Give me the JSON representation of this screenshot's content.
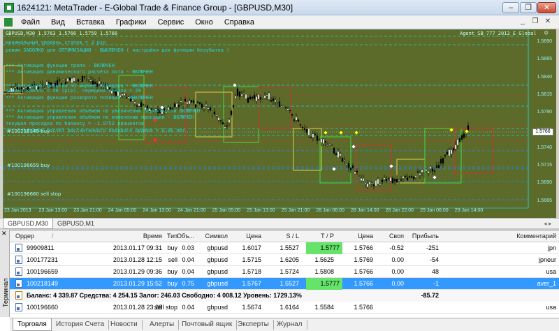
{
  "window": {
    "title": "1624121: MetaTrader - E-Global Trade & Finance Group - [GBPUSD,M30]"
  },
  "menu": [
    "Файл",
    "Вид",
    "Вставка",
    "Графики",
    "Сервис",
    "Окно",
    "Справка"
  ],
  "chart": {
    "symbol_line": "GBPUSD,M30  1.5763 1.5766 1.5759 1.5766",
    "expert_name": "Agent_SB_777_2013_E Global",
    "overlay_lines": [
      "минимальный уровень стопов =  3  pip",
      "режим ЗАБОЛКО для ОПТИМИЗАЦИИ - ВЫКЛЮЧЕН  ( настройки для функции безубытка )",
      "*** Активация функции трала - ВКЛЮЧЕН",
      "*** Активация динамического расчёта лота - ВКЛЮЧЕН",
      "*** Активация фильтра по ширине коридора - ВКЛЮЧЕН",
      "ширина канала = 58 (pip), середина канала = 29",
      "*** Активация функции разворота позиции - ВЫКЛЮЧЕН",
      "*** Активация управления объёмом по увеличению вероятности ВКЛЮЧЕН",
      "*** Активация управления объёмом по изменению просадки - ВКЛЮЧЕН",
      "текущая просадка по балансу = -1.9752 процентов",
      "*** Стартовый расчёт рассчитанного базового ордера = 0.06 лот"
    ],
    "order_labels": [
      "#100218149 buy",
      "#100196659 buy",
      "#100196660 sell stop"
    ],
    "price_ticks": [
      "1.5890",
      "1.5865",
      "1.5840",
      "1.5815",
      "1.5790",
      "1.5766",
      "1.5740",
      "1.5715",
      "1.5690",
      "1.5665"
    ],
    "current_price": "1.5766",
    "time_ticks": [
      "23 Jan 2013",
      "23 Jan 13:00",
      "23 Jan 21:00",
      "24 Jan 05:00",
      "24 Jan 13:00",
      "24 Jan 21:00",
      "25 Jan 05:00",
      "25 Jan 13:00",
      "25 Jan 21:00",
      "28 Jan 06:00",
      "28 Jan 14:00",
      "28 Jan 22:00",
      "29 Jan 06:00",
      "29 Jan 14:00"
    ],
    "colors": {
      "background": "#5c6b2a",
      "text": "#21d4e0",
      "bull": "#ffffff",
      "bear": "#000000"
    }
  },
  "chart_tabs": [
    "GBPUSD,M30",
    "GBPUSD,M1"
  ],
  "terminal": {
    "side_title": "Терминал",
    "columns": [
      "Ордер",
      "/",
      "Время",
      "Тип",
      "Объ...",
      "Символ",
      "Цена",
      "S / L",
      "T / P",
      "Цена",
      "Своп",
      "Прибыль",
      "Комментарий"
    ],
    "rows": [
      {
        "order": "99909811",
        "time": "2013.01.17 09:31",
        "type": "buy",
        "volume": "0.03",
        "symbol": "gbpusd",
        "price": "1.6017",
        "sl": "1.5527",
        "tp": "1.5777",
        "cur": "1.5766",
        "swap": "-0.52",
        "profit": "-251",
        "comment": "jpn"
      },
      {
        "order": "100177231",
        "time": "2013.01.28 12:15",
        "type": "sell",
        "volume": "0.04",
        "symbol": "gbpusd",
        "price": "1.5715",
        "sl": "1.6205",
        "tp": "1.5625",
        "cur": "1.5769",
        "swap": "0.00",
        "profit": "-54",
        "comment": "jpneur"
      },
      {
        "order": "100196659",
        "time": "2013.01.29 09:36",
        "type": "buy",
        "volume": "0.04",
        "symbol": "gbpusd",
        "price": "1.5718",
        "sl": "1.5724",
        "tp": "1.5808",
        "cur": "1.5766",
        "swap": "0.00",
        "profit": "48",
        "comment": "usa"
      },
      {
        "order": "100218149",
        "time": "2013.01.29 15:52",
        "type": "buy",
        "volume": "0.75",
        "symbol": "gbpusd",
        "price": "1.5767",
        "sl": "1.5527",
        "tp": "1.5777",
        "cur": "1.5766",
        "swap": "0.00",
        "profit": "-1",
        "comment": "aver_1"
      }
    ],
    "summary": {
      "text": "Баланс: 4 339.87  Средства: 4 254.15  Залог: 246.03  Свободно: 4 008.12  Уровень: 1729.13%",
      "profit": "-85.72"
    },
    "pending": {
      "order": "100196660",
      "time": "2013.01.28 23:28",
      "type": "sell stop",
      "volume": "0.04",
      "symbol": "gbpusd",
      "price": "1.5674",
      "sl": "1.6164",
      "tp": "1.5584",
      "cur": "1.5766",
      "comment": "usa"
    }
  },
  "bottom_tabs": [
    "Торговля",
    "История Счета",
    "Новости",
    "Алерты",
    "Почтовый ящик",
    "Эксперты",
    "Журнал"
  ]
}
